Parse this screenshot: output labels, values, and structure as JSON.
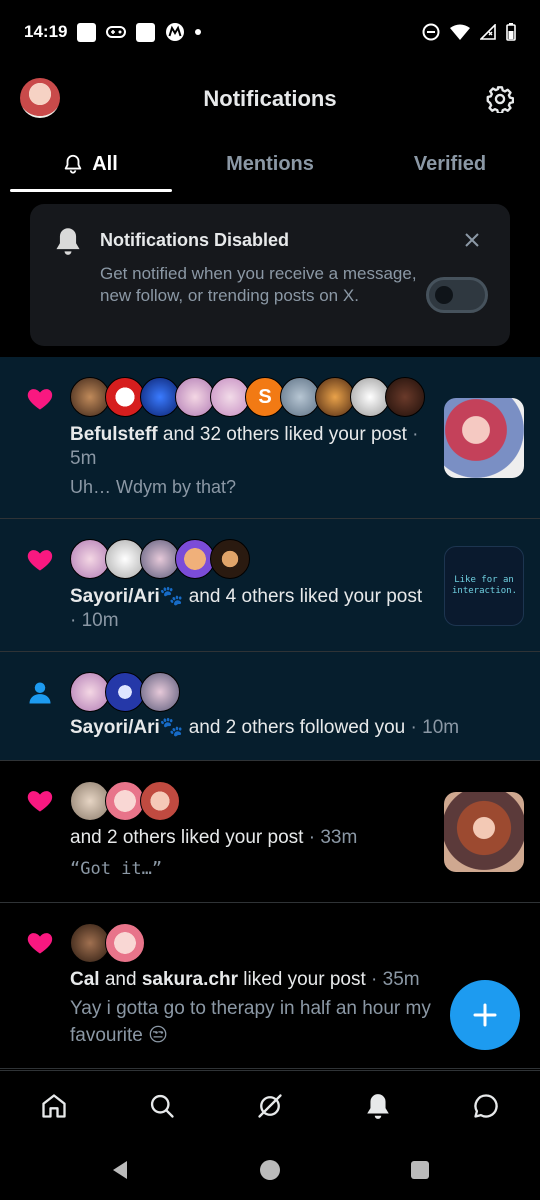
{
  "status_bar": {
    "time": "14:19"
  },
  "header": {
    "title": "Notifications"
  },
  "tabs": [
    {
      "label": "All",
      "active": true
    },
    {
      "label": "Mentions",
      "active": false
    },
    {
      "label": "Verified",
      "active": false
    }
  ],
  "banner": {
    "title": "Notifications Disabled",
    "text": "Get notified when you receive a message, new follow, or trending posts on X.",
    "toggle_on": false
  },
  "notifications": [
    {
      "type": "like",
      "actor": "Befulsteff",
      "rest": " and 32 others liked your post",
      "time": "5m",
      "preview": "Uh… Wdym by that?",
      "unread": true,
      "avatar_letter": "S"
    },
    {
      "type": "like",
      "actor": "Sayori/Ari🐾",
      "rest": " and 4 others liked your post",
      "time": "10m",
      "preview": "",
      "unread": true,
      "thumb_text": "Like for an interaction."
    },
    {
      "type": "follow",
      "actor": "Sayori/Ari🐾",
      "rest": " and 2 others followed you",
      "time": "10m",
      "unread": true
    },
    {
      "type": "like",
      "actor": "",
      "rest": " and 2 others liked your post",
      "time": "33m",
      "preview": "“Got it…”",
      "unread": false
    },
    {
      "type": "like",
      "actor": "Cal",
      "joiner": " and ",
      "actor2": "sakura.chr",
      "rest": " liked your post",
      "time": "35m",
      "preview": "Yay i gotta go to therapy in half an hour my favourite 😒",
      "unread": false
    }
  ],
  "colors": {
    "accent": "#1d9bf0",
    "like": "#f91880",
    "unread_bg": "#061e2d"
  }
}
